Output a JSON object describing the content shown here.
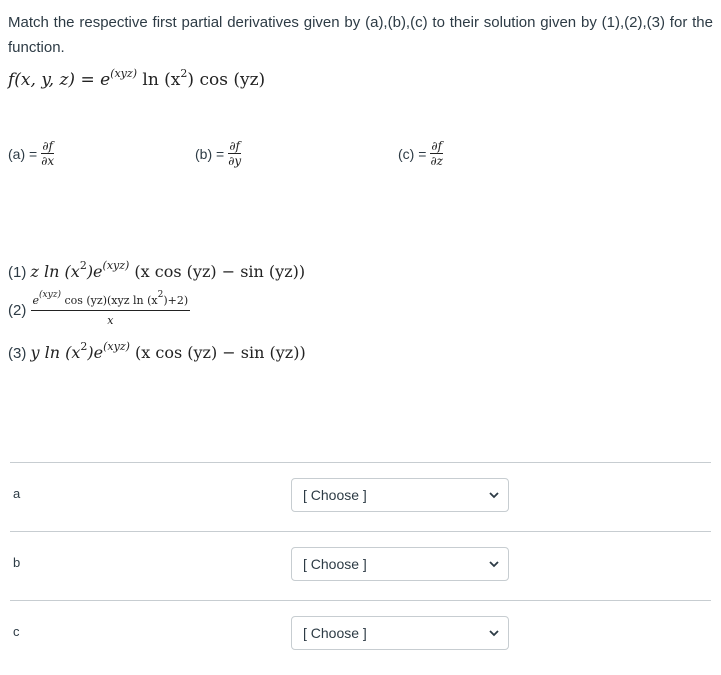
{
  "question": {
    "prompt": "Match the respective first partial derivatives given by (a),(b),(c) to their solution given by (1),(2),(3) for the function."
  },
  "function": {
    "lhs": "f(x, y, z) = e",
    "exp": "(xyz)",
    "rhs1": " ln (x",
    "sq": "2",
    "rhs2": ") cos (yz)"
  },
  "derivatives": [
    {
      "label": "(a) =",
      "num": "∂f",
      "den": "∂x"
    },
    {
      "label": "(b) =",
      "num": "∂f",
      "den": "∂y"
    },
    {
      "label": "(c) =",
      "num": "∂f",
      "den": "∂z"
    }
  ],
  "solutions": [
    {
      "label": "(1)",
      "p1": "z ln (x",
      "sq": "2",
      "p2": ")e",
      "exp": "(xyz)",
      "p3": " (x cos (yz) − sin (yz))"
    },
    {
      "label": "(2)",
      "numerator_a": "e",
      "numerator_exp": "(xyz)",
      "numerator_b": " cos (yz)(xyz ln (x",
      "numerator_sq": "2",
      "numerator_c": ")+2)",
      "denominator": "x"
    },
    {
      "label": "(3)",
      "p1": "y ln (x",
      "sq": "2",
      "p2": ")e",
      "exp": "(xyz)",
      "p3": " (x cos (yz) − sin (yz))"
    }
  ],
  "matches": [
    {
      "label": "a",
      "selected": "[ Choose ]"
    },
    {
      "label": "b",
      "selected": "[ Choose ]"
    },
    {
      "label": "c",
      "selected": "[ Choose ]"
    }
  ],
  "icons": {
    "dropdown": "chevron-down-icon"
  },
  "colors": {
    "text": "#2d3b45",
    "border": "#c7cdd1"
  }
}
